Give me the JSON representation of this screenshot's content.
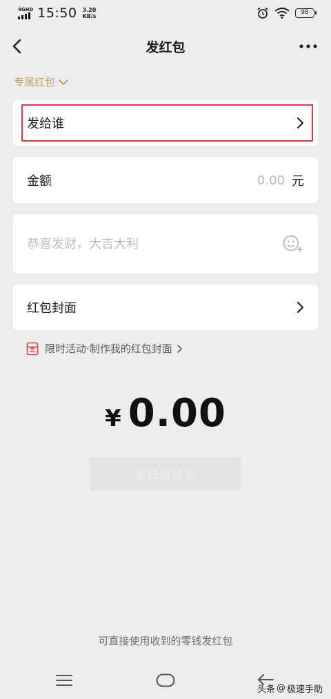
{
  "status_bar": {
    "network": "4GHD",
    "time": "15:50",
    "speed_value": "3.20",
    "speed_unit": "KB/s",
    "battery": "98"
  },
  "header": {
    "title": "发红包",
    "back_icon": "chevron-left-icon",
    "more_icon": "more-dots-icon"
  },
  "packet_type": {
    "label": "专属红包",
    "color": "#c8a067"
  },
  "recipient": {
    "label": "发给谁"
  },
  "amount": {
    "label": "金额",
    "value": "0.00",
    "unit": "元"
  },
  "greeting": {
    "placeholder": "恭喜发财，大吉大利"
  },
  "cover": {
    "label": "红包封面"
  },
  "promo": {
    "text": "限时活动·制作我的红包封面"
  },
  "total": {
    "currency": "¥",
    "value": "0.00"
  },
  "submit": {
    "label": "塞钱进红包"
  },
  "footer": {
    "note": "可直接使用收到的零钱发红包"
  },
  "watermark": {
    "prefix": "头条",
    "at": "@",
    "name": "极速手助"
  },
  "colors": {
    "highlight": "#d63b3f",
    "accent": "#c8a067",
    "background": "#ededed"
  }
}
